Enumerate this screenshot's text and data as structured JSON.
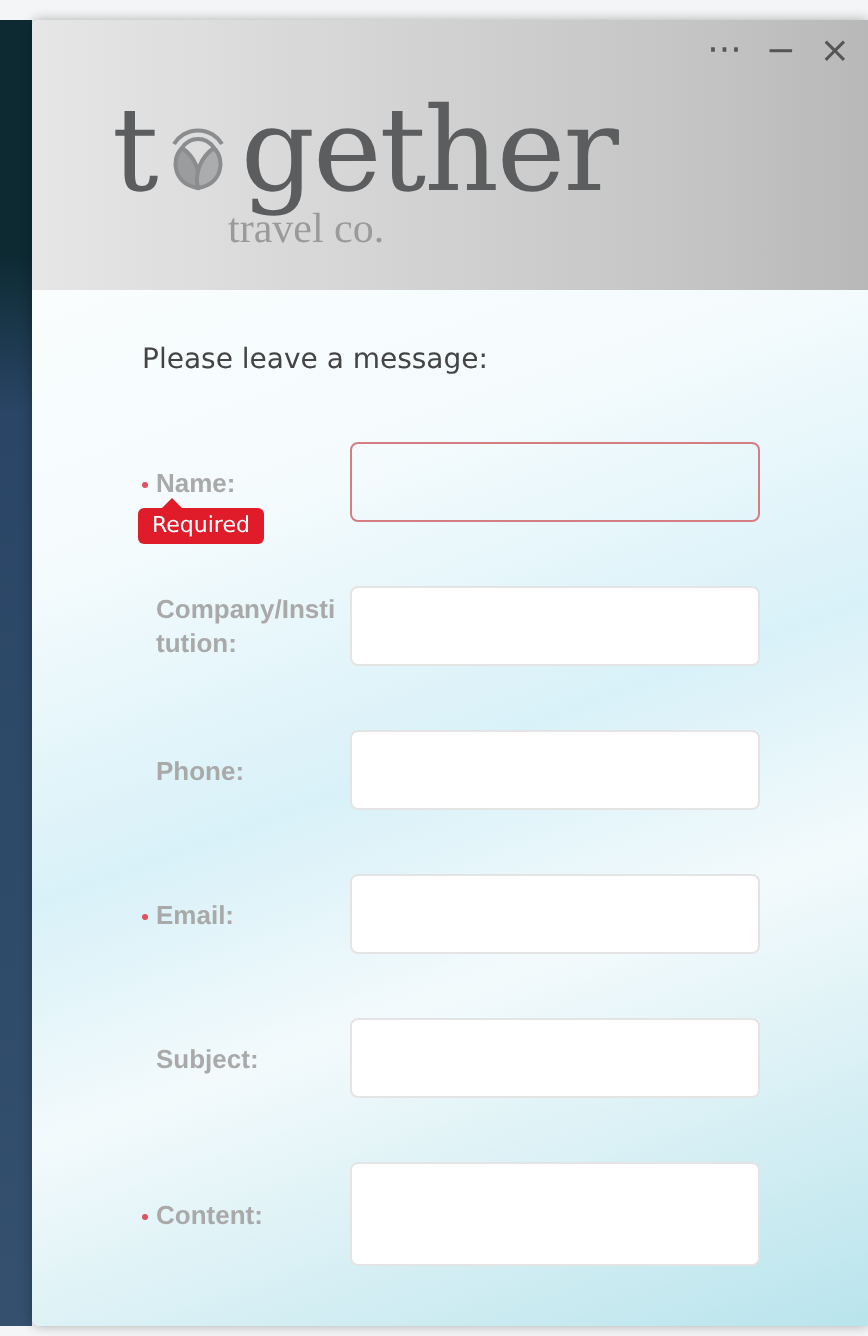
{
  "window": {
    "controls": [
      "···",
      "−",
      "×"
    ]
  },
  "logo": {
    "before": "t",
    "after": "gether",
    "tagline": "travel co."
  },
  "form": {
    "heading": "Please leave a message:",
    "fields": [
      {
        "label": "Name:",
        "required": true,
        "invalid": true,
        "error": "Required",
        "kind": "line"
      },
      {
        "label": "Company/Institution:",
        "required": false,
        "invalid": false,
        "kind": "line"
      },
      {
        "label": "Phone:",
        "required": false,
        "invalid": false,
        "kind": "line"
      },
      {
        "label": "Email:",
        "required": true,
        "invalid": false,
        "kind": "line"
      },
      {
        "label": "Subject:",
        "required": false,
        "invalid": false,
        "kind": "line"
      },
      {
        "label": "Content:",
        "required": true,
        "invalid": false,
        "kind": "area"
      }
    ]
  }
}
